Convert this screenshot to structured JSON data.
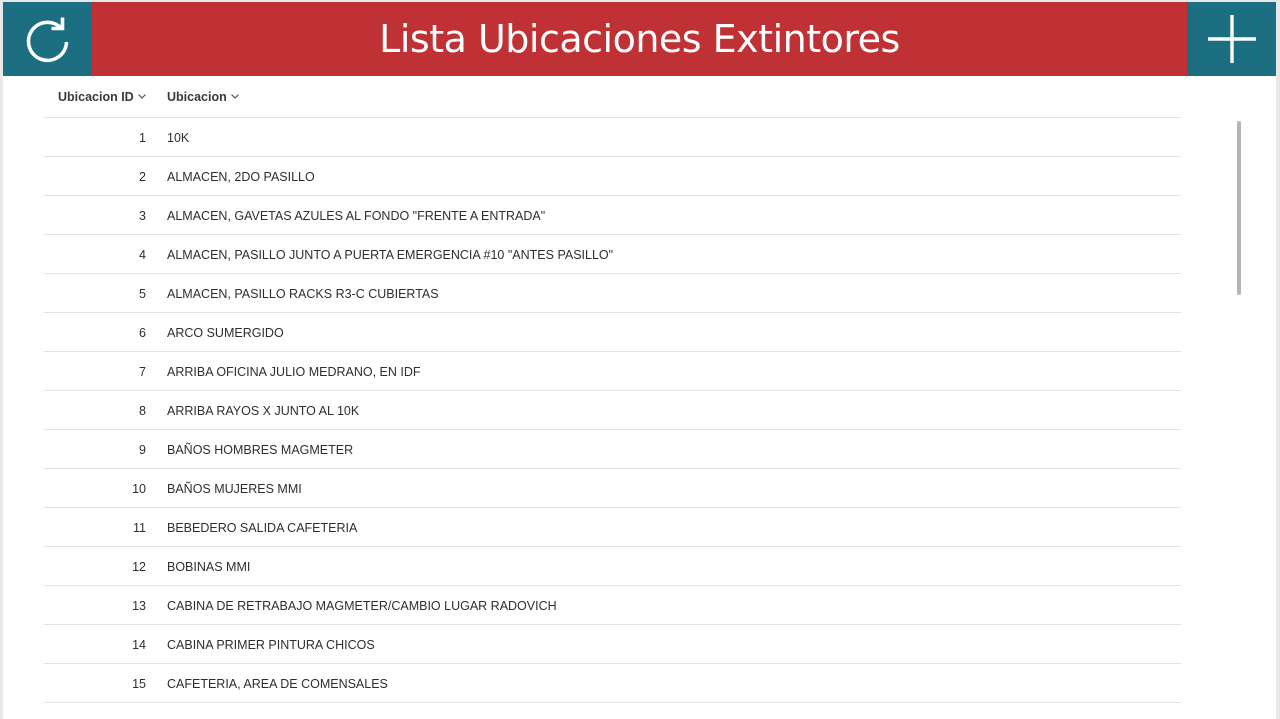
{
  "header": {
    "title": "Lista Ubicaciones Extintores",
    "refresh_icon": "refresh-icon",
    "add_icon": "plus-icon",
    "bar_color": "#bf3134",
    "button_color": "#1b6f80"
  },
  "table": {
    "columns": [
      {
        "label": "Ubicacion ID",
        "sort_icon": "chevron-down-icon"
      },
      {
        "label": "Ubicacion",
        "sort_icon": "chevron-down-icon"
      }
    ],
    "rows": [
      {
        "id": "1",
        "ubicacion": "10K"
      },
      {
        "id": "2",
        "ubicacion": "ALMACEN, 2DO PASILLO"
      },
      {
        "id": "3",
        "ubicacion": "ALMACEN, GAVETAS AZULES AL FONDO \"FRENTE A ENTRADA\""
      },
      {
        "id": "4",
        "ubicacion": "ALMACEN, PASILLO JUNTO A PUERTA EMERGENCIA #10 \"ANTES PASILLO\""
      },
      {
        "id": "5",
        "ubicacion": "ALMACEN, PASILLO RACKS R3-C CUBIERTAS"
      },
      {
        "id": "6",
        "ubicacion": "ARCO SUMERGIDO"
      },
      {
        "id": "7",
        "ubicacion": "ARRIBA OFICINA JULIO MEDRANO, EN IDF"
      },
      {
        "id": "8",
        "ubicacion": "ARRIBA RAYOS X JUNTO AL 10K"
      },
      {
        "id": "9",
        "ubicacion": "BAÑOS HOMBRES MAGMETER"
      },
      {
        "id": "10",
        "ubicacion": "BAÑOS MUJERES MMI"
      },
      {
        "id": "11",
        "ubicacion": "BEBEDERO SALIDA CAFETERIA"
      },
      {
        "id": "12",
        "ubicacion": "BOBINAS MMI"
      },
      {
        "id": "13",
        "ubicacion": "CABINA DE RETRABAJO MAGMETER/CAMBIO LUGAR RADOVICH"
      },
      {
        "id": "14",
        "ubicacion": "CABINA PRIMER PINTURA CHICOS"
      },
      {
        "id": "15",
        "ubicacion": "CAFETERIA, AREA DE COMENSALES"
      }
    ]
  }
}
